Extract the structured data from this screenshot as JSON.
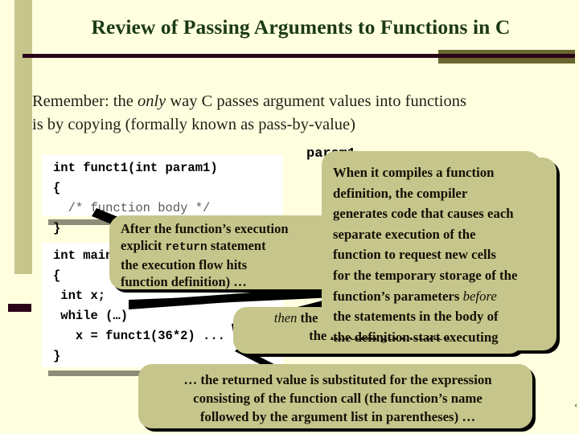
{
  "slide": {
    "title": "Review of Passing Arguments to Functions in C",
    "intro": {
      "line1_a": "Remember: the ",
      "line1_em": "only",
      "line1_b": " way C passes argument values into functions",
      "line2": "is by copying (formally known as pass-by-value)"
    },
    "background_label": "param1",
    "edge_mark": "‹"
  },
  "code_blocks": [
    {
      "name": "function-definition",
      "lines": [
        {
          "text": "int funct1(int param1)",
          "style": "code"
        },
        {
          "text": "{",
          "style": "code"
        },
        {
          "text": "  /* function body */",
          "style": "comment"
        },
        {
          "text": "}",
          "style": "code"
        }
      ]
    },
    {
      "name": "main-function",
      "lines": [
        {
          "text": "int main()",
          "style": "code"
        },
        {
          "text": "{",
          "style": "code"
        },
        {
          "text": " int x;",
          "style": "code"
        },
        {
          "text": " while (…)",
          "style": "code"
        },
        {
          "text": "   x = funct1(36*2) ...",
          "style": "code"
        },
        {
          "text": "}",
          "style": "code"
        }
      ]
    }
  ],
  "callouts": {
    "after_execution": {
      "line1": "After the function’s execution",
      "line2_a": "explicit ",
      "line2_mono": "return",
      "line2_b": " statement",
      "line3": "the execution flow hits",
      "line4": "function definition) …"
    },
    "compiler": {
      "line1": "When it compiles a function",
      "line2": "definition, the compiler",
      "line3": "generates code that causes each",
      "line4": "separate execution of the",
      "line5": "function to request new cells",
      "line6": "for the temporary storage of the",
      "line7_a": "function’s parameters ",
      "line7_em": "before",
      "line8": "the statements in the body of",
      "line9": "the definition start executing"
    },
    "then_statements": {
      "line1_em": "then",
      "line1_b": " the statements inside the body of",
      "line2": "the function get executed"
    },
    "returned_value": {
      "line1": "… the returned value is substituted for the expression",
      "line2": "consisting of the function call (the function’s name",
      "line3": "followed by the argument list in parentheses) …"
    }
  },
  "colors": {
    "background": "#FFFFE0",
    "title": "#1C3A14",
    "rule_maroon": "#2B0318",
    "rule_olive": "#6B6630",
    "balloon": "#C6C68C",
    "sidebar": "#C6C68C",
    "code_background": "#FFFFFF",
    "code_shadow": "#8C8C78"
  }
}
